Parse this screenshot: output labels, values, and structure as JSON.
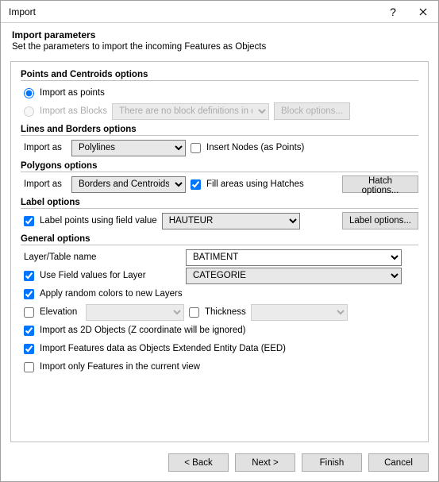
{
  "title": "Import",
  "subtitle": "Import parameters",
  "subdesc": "Set the parameters to import the incoming Features as Objects",
  "group_pc": {
    "title": "Points and Centroids options",
    "opt_points": "Import as points",
    "opt_blocks": "Import as Blocks",
    "block_sel": "There are no block definitions in drawing",
    "block_btn": "Block options..."
  },
  "group_lb": {
    "title": "Lines and Borders options",
    "import_as": "Import as",
    "sel": "Polylines",
    "insert_nodes": "Insert Nodes (as Points)"
  },
  "group_pg": {
    "title": "Polygons options",
    "import_as": "Import as",
    "sel": "Borders and Centroids",
    "fill": "Fill areas using Hatches",
    "btn": "Hatch options..."
  },
  "group_lbl": {
    "title": "Label options",
    "use_field": "Label points using field value",
    "sel": "HAUTEUR",
    "btn": "Label options..."
  },
  "group_gen": {
    "title": "General options",
    "layer_name": "Layer/Table name",
    "layer_val": "BATIMENT",
    "use_field_layer": "Use Field values for Layer",
    "field_sel": "CATEGORIE",
    "apply_colors": "Apply random colors to new Layers",
    "elevation": "Elevation",
    "thickness": "Thickness",
    "as2d": "Import as 2D Objects (Z coordinate will be ignored)",
    "eed": "Import Features data as Objects Extended Entity Data (EED)",
    "curview": "Import only Features in the current view"
  },
  "footer": {
    "back": "< Back",
    "next": "Next >",
    "finish": "Finish",
    "cancel": "Cancel"
  }
}
